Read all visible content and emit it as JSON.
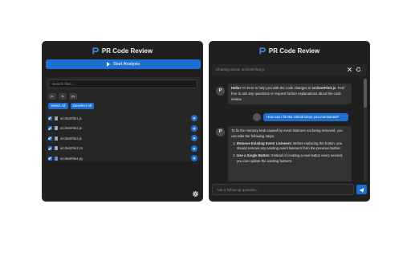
{
  "left_panel": {
    "title": "PR Code Review",
    "start_button": "Start Analysis",
    "search_placeholder": "Search files...",
    "filters": [
      "js",
      "ts",
      "py"
    ],
    "select_all": "Select All",
    "deselect_all": "Deselect All",
    "files": [
      {
        "name": "src/testFile1.js",
        "icon": "file-icon",
        "action": "view-icon"
      },
      {
        "name": "src/testFile2.js",
        "icon": "file-icon",
        "action": "view-icon"
      },
      {
        "name": "src/testFile3.js",
        "icon": "file-icon",
        "action": "view-icon"
      },
      {
        "name": "src/testFile3.cs",
        "icon": "file-icon",
        "action": "view-icon"
      },
      {
        "name": "src/testFile4.py",
        "icon": "python-file-icon",
        "action": "view-icon"
      }
    ],
    "settings_icon": "gear-icon"
  },
  "right_panel": {
    "title": "PR Code Review",
    "chatting_about": "Chatting about: src/testFile3.js",
    "avatar_letter": "P",
    "assistant_msg1": {
      "hello": "Hello!",
      "intro": " I'm here to help you with the code changes in ",
      "file": "src/testFile3.js",
      "rest": ". Feel free to ask any questions or request further explanations about the code review."
    },
    "user_msg": "How can I fix the critical issue you mentioned?",
    "assistant_msg2": {
      "intro": "To fix the memory leak caused by event listeners not being removed, you can take the following steps:",
      "steps": [
        {
          "title": "Remove Existing Event Listeners",
          "text": ": Before replacing the button, you should remove any existing event listeners from the previous button."
        },
        {
          "title": "Use a Single Button",
          "text": ": Instead of creating a new button every second, you can update the existing button's"
        }
      ]
    },
    "input_placeholder": "Ask a follow-up question...",
    "colors": {
      "accent": "#1e6fd0",
      "panel": "#1f1f1f"
    }
  }
}
